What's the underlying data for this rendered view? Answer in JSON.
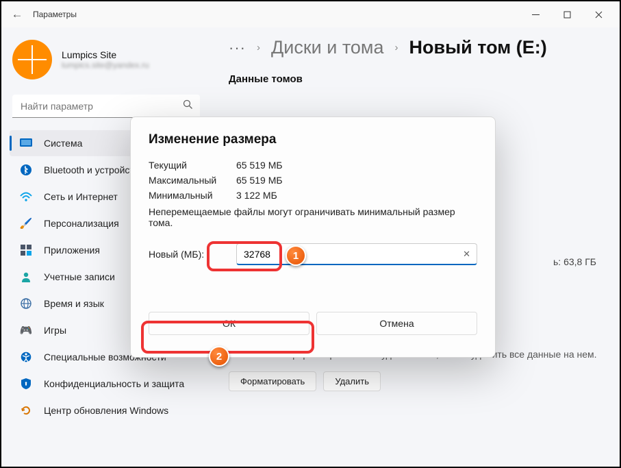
{
  "titlebar": {
    "title": "Параметры"
  },
  "profile": {
    "name": "Lumpics Site",
    "email": "lumpics.site@yandex.ru"
  },
  "search": {
    "placeholder": "Найти параметр"
  },
  "nav": [
    {
      "label": "Система",
      "icon": "🖥️"
    },
    {
      "label": "Bluetooth и устройства",
      "icon": "bt"
    },
    {
      "label": "Сеть и Интернет",
      "icon": "net"
    },
    {
      "label": "Персонализация",
      "icon": "🖌️"
    },
    {
      "label": "Приложения",
      "icon": "apps"
    },
    {
      "label": "Учетные записи",
      "icon": "👤"
    },
    {
      "label": "Время и язык",
      "icon": "🌐"
    },
    {
      "label": "Игры",
      "icon": "🎮"
    },
    {
      "label": "Специальные возможности",
      "icon": "acc"
    },
    {
      "label": "Конфиденциальность и защита",
      "icon": "🛡️"
    },
    {
      "label": "Центр обновления Windows",
      "icon": "upd"
    }
  ],
  "crumbs": {
    "dots": "···",
    "a": "Диски и тома",
    "b": "Новый том (E:)"
  },
  "sections": {
    "data": "Данные томов",
    "format": "Форматировать"
  },
  "storage": {
    "free_text": "ь: 63,8 ГБ"
  },
  "format": {
    "desc": "Вы можете отформатировать или удалить том, чтобы удалить все данные на нем.",
    "btn1": "Форматировать",
    "btn2": "Удалить"
  },
  "modal": {
    "title": "Изменение размера",
    "cur_lbl": "Текущий",
    "cur_val": "65 519 МБ",
    "max_lbl": "Максимальный",
    "max_val": "65 519 МБ",
    "min_lbl": "Минимальный",
    "min_val": "3 122 МБ",
    "note": "Неперемещаемые файлы могут ограничивать минимальный размер тома.",
    "new_lbl": "Новый (МБ):",
    "new_val": "32768",
    "ok": "ОК",
    "cancel": "Отмена"
  },
  "badges": {
    "one": "1",
    "two": "2"
  }
}
